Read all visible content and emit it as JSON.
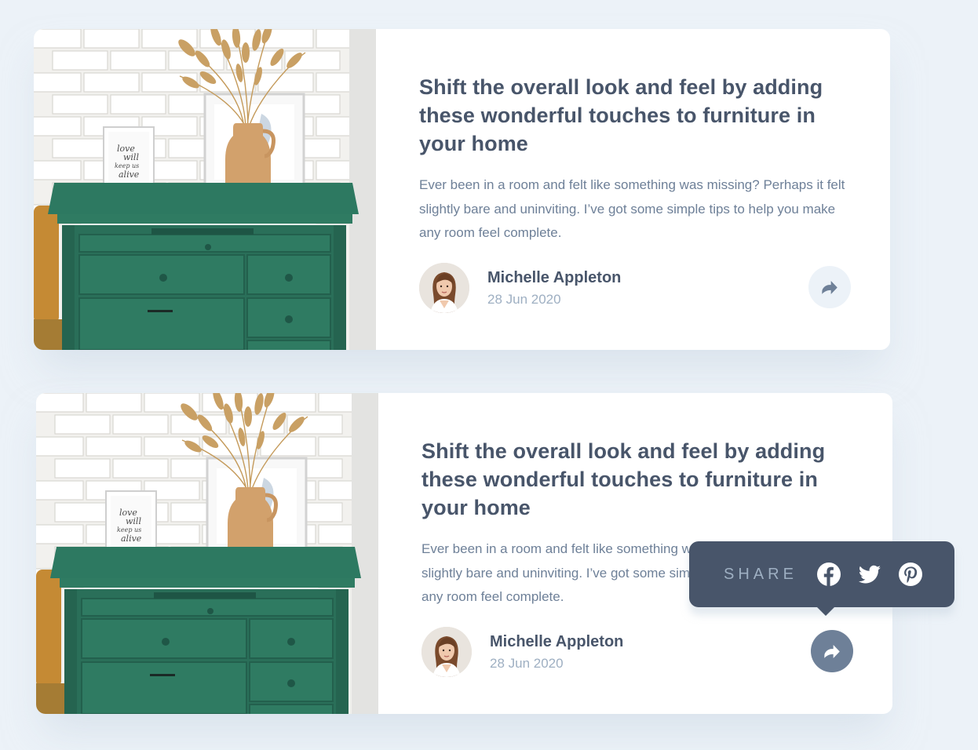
{
  "cards": [
    {
      "title": "Shift the overall look and feel by adding these wonderful touches to furniture in your home",
      "excerpt": "Ever been in a room and felt like something was missing? Perhaps it felt slightly bare and uninviting. I’ve got some simple tips to help you make any room feel complete.",
      "author": {
        "name": "Michelle Appleton",
        "date": "28 Jun 2020"
      },
      "share_icon": "share-arrow-icon",
      "share_state": "inactive"
    },
    {
      "title": "Shift the overall look and feel by adding these wonderful touches to furniture in your home",
      "excerpt": "Ever been in a room and felt like something was missing? Perhaps it felt slightly bare and uninviting. I’ve got some simple tips to help you make any room feel complete.",
      "author": {
        "name": "Michelle Appleton",
        "date": "28 Jun 2020"
      },
      "share_icon": "share-arrow-icon",
      "share_state": "active"
    }
  ],
  "share_popover": {
    "label": "SHARE",
    "icons": [
      "facebook-icon",
      "twitter-icon",
      "pinterest-icon"
    ]
  },
  "colors": {
    "background": "#ecf2f8",
    "title": "#48556a",
    "body_text": "#6e8098",
    "muted": "#9eafc2",
    "popover": "#48556a",
    "share_active": "#6e8098"
  },
  "image_text": [
    "love",
    "will",
    "keep us",
    "alive"
  ]
}
